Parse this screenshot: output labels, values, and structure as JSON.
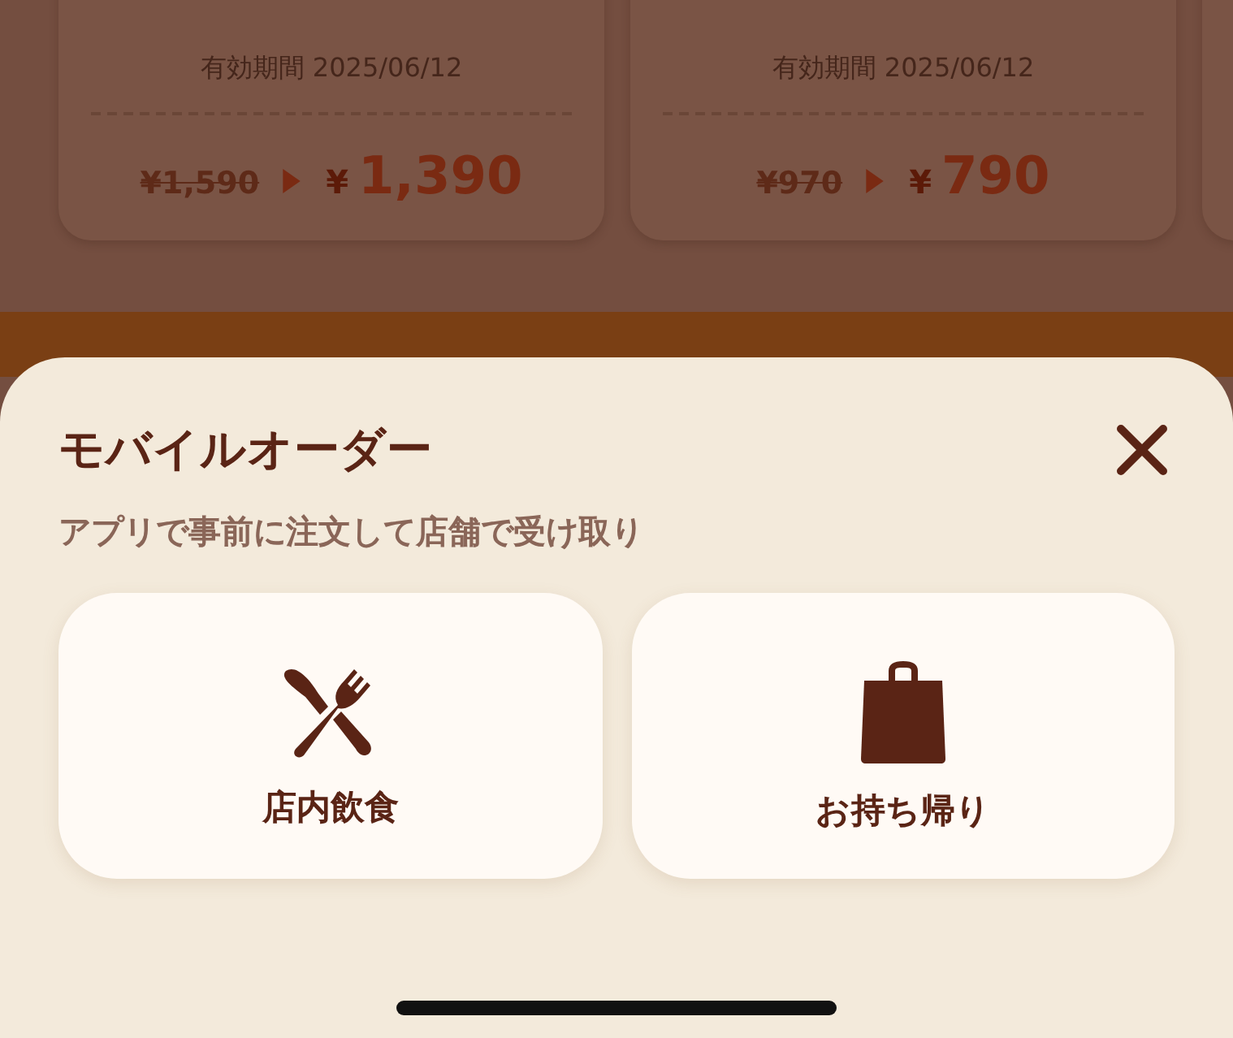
{
  "coupons": [
    {
      "validity": "有効期間 2025/06/12",
      "old_price": "¥1,590",
      "new_currency": "¥",
      "new_price": "1,390"
    },
    {
      "validity": "有効期間 2025/06/12",
      "old_price": "¥970",
      "new_currency": "¥",
      "new_price": "790"
    }
  ],
  "sheet": {
    "title": "モバイルオーダー",
    "subtitle": "アプリで事前に注文して店舗で受け取り",
    "options": [
      {
        "kind": "dine_in",
        "label": "店内飲食"
      },
      {
        "kind": "takeout",
        "label": "お持ち帰り"
      }
    ]
  }
}
